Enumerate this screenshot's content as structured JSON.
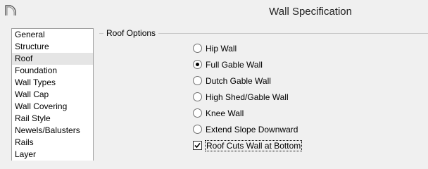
{
  "window": {
    "title": "Wall Specification",
    "icon": "app-icon"
  },
  "sidebar": {
    "items": [
      {
        "label": "General",
        "selected": false
      },
      {
        "label": "Structure",
        "selected": false
      },
      {
        "label": "Roof",
        "selected": true
      },
      {
        "label": "Foundation",
        "selected": false
      },
      {
        "label": "Wall Types",
        "selected": false
      },
      {
        "label": "Wall Cap",
        "selected": false
      },
      {
        "label": "Wall Covering",
        "selected": false
      },
      {
        "label": "Rail Style",
        "selected": false
      },
      {
        "label": "Newels/Balusters",
        "selected": false
      },
      {
        "label": "Rails",
        "selected": false
      },
      {
        "label": "Layer",
        "selected": false
      }
    ]
  },
  "roof_options": {
    "legend": "Roof Options",
    "radios": [
      {
        "label": "Hip Wall",
        "checked": false
      },
      {
        "label": "Full Gable Wall",
        "checked": true
      },
      {
        "label": "Dutch Gable Wall",
        "checked": false
      },
      {
        "label": "High Shed/Gable Wall",
        "checked": false
      },
      {
        "label": "Knee Wall",
        "checked": false
      },
      {
        "label": "Extend Slope Downward",
        "checked": false
      }
    ],
    "checkbox": {
      "label": "Roof Cuts Wall at Bottom",
      "checked": true
    }
  }
}
